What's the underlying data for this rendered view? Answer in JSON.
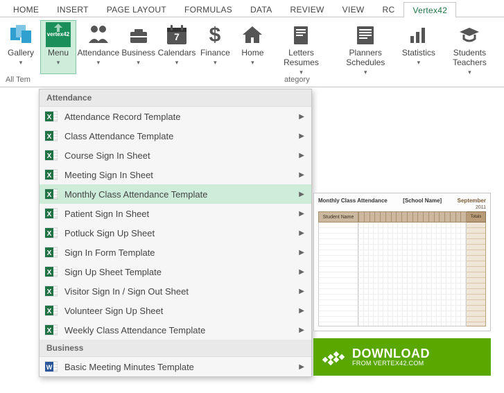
{
  "tabs": {
    "items": [
      "HOME",
      "INSERT",
      "PAGE LAYOUT",
      "FORMULAS",
      "DATA",
      "REVIEW",
      "VIEW",
      "RC",
      "Vertex42"
    ],
    "active": "Vertex42"
  },
  "ribbon": {
    "items": [
      {
        "label": "Gallery",
        "drop": "▾",
        "icon": "gallery"
      },
      {
        "label": "Menu",
        "drop": "▾",
        "icon": "vertex42",
        "active": true
      },
      {
        "label": "Attendance",
        "drop": "▾",
        "icon": "attendance"
      },
      {
        "label": "Business",
        "drop": "▾",
        "icon": "business"
      },
      {
        "label": "Calendars",
        "drop": "▾",
        "icon": "calendar"
      },
      {
        "label": "Finance",
        "drop": "▾",
        "icon": "finance"
      },
      {
        "label": "Home",
        "drop": "▾",
        "icon": "home"
      },
      {
        "label": "Letters Resumes",
        "drop": "▾",
        "icon": "letters"
      },
      {
        "label": "Planners Schedules",
        "drop": "▾",
        "icon": "planners"
      },
      {
        "label": "Statistics",
        "drop": "▾",
        "icon": "statistics"
      },
      {
        "label": "Students Teachers",
        "drop": "▾",
        "icon": "students"
      }
    ],
    "category_left": "All Tem",
    "category_right": "ategory"
  },
  "menu": {
    "sections": [
      {
        "header": "Attendance",
        "icon": "excel",
        "items": [
          "Attendance Record Template",
          "Class Attendance Template",
          "Course Sign In Sheet",
          "Meeting Sign In Sheet",
          "Monthly Class Attendance Template",
          "Patient Sign In Sheet",
          "Potluck Sign Up Sheet",
          "Sign In Form Template",
          "Sign Up Sheet Template",
          "Visitor Sign In / Sign Out Sheet",
          "Volunteer Sign Up Sheet",
          "Weekly Class Attendance Template"
        ],
        "hover_index": 4
      },
      {
        "header": "Business",
        "icon": "word",
        "items": [
          "Basic Meeting Minutes Template"
        ]
      }
    ]
  },
  "preview": {
    "title": "Monthly Class Attendance",
    "school": "[School Name]",
    "month": "September",
    "year": "2011",
    "col_student": "Student Name",
    "col_totals": "Totals"
  },
  "download": {
    "big": "DOWNLOAD",
    "small": "FROM VERTEX42.COM"
  }
}
